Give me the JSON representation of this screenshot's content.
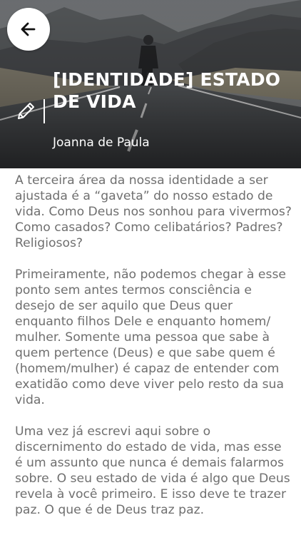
{
  "header": {
    "back_icon": "arrow-left-icon",
    "edit_icon": "pencil-icon",
    "title": "[IDENTIDADE] ESTADO DE VIDA",
    "author": "Joanna de Paula"
  },
  "article": {
    "paragraphs": [
      "A terceira área da nossa identidade a ser ajustada é a “gaveta” do nosso estado de vida. Como Deus nos sonhou para vivermos? Como casados? Como celibatários? Padres? Religiosos?",
      "Primeiramente, não podemos chegar à esse ponto sem antes termos consciência e desejo de ser aquilo que Deus quer enquanto filhos Dele e enquanto homem/ mulher. Somente uma pessoa que sabe à quem pertence (Deus) e que sabe quem é (homem/mulher) é capaz de entender com exatidão como deve viver pelo resto da sua vida.",
      "Uma vez já escrevi aqui sobre o discernimento do estado de vida, mas esse é um assunto que nunca é demais falarmos sobre. O seu estado de vida é algo que Deus revela à você primeiro. E isso deve te trazer paz. O que é de Deus traz paz."
    ]
  },
  "colors": {
    "title_text": "#ffffff",
    "body_text": "#6f6f6f",
    "back_button_bg": "#ffffff"
  }
}
